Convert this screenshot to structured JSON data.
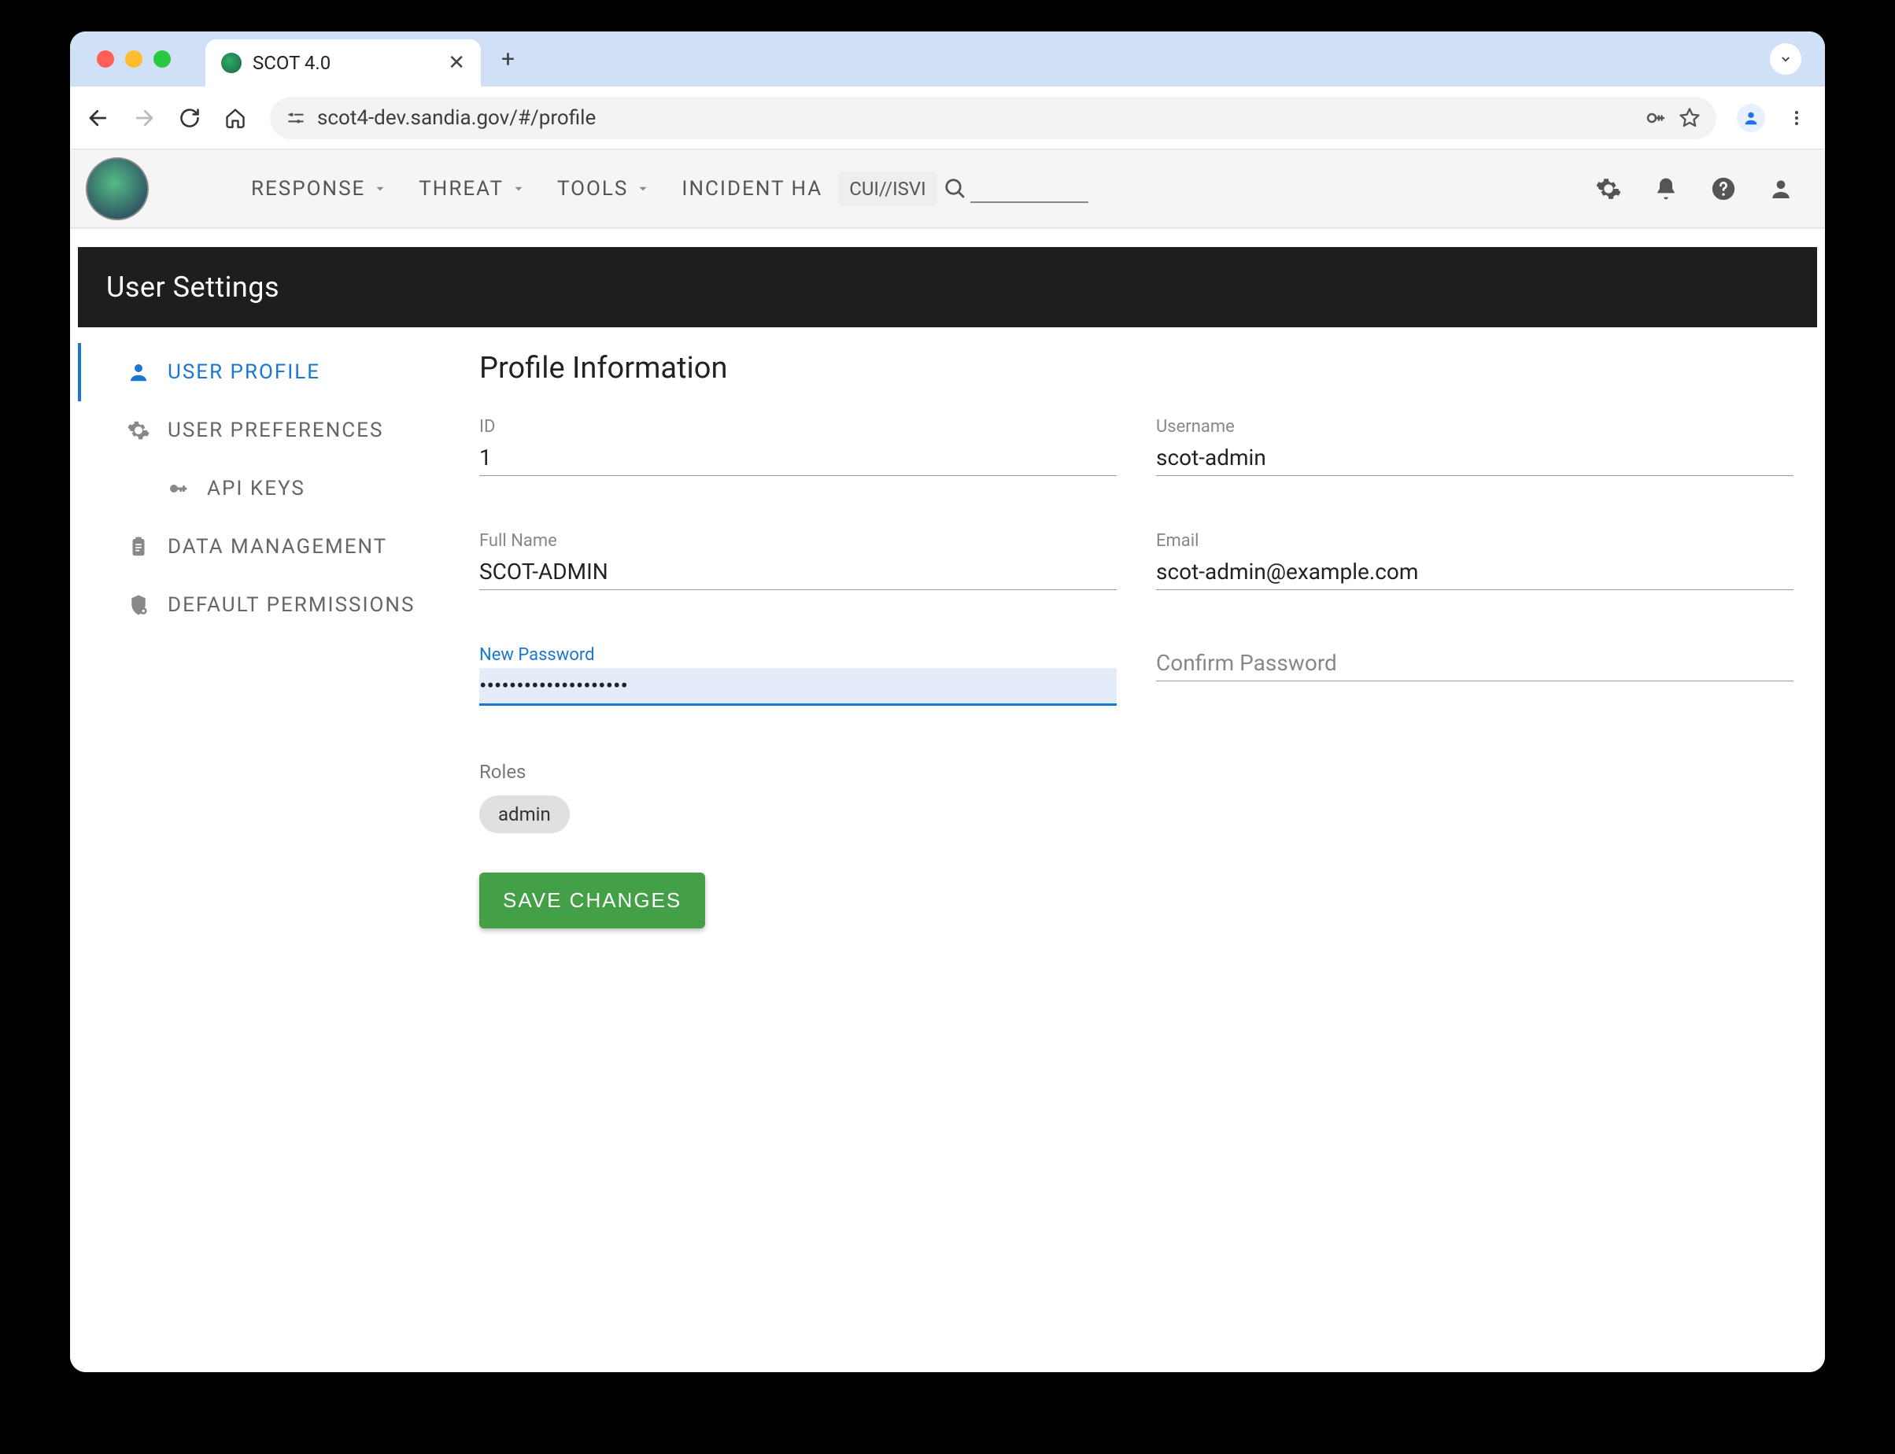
{
  "browser": {
    "tab_title": "SCOT 4.0",
    "url": "scot4-dev.sandia.gov/#/profile"
  },
  "app_nav": {
    "items": [
      "RESPONSE",
      "THREAT",
      "TOOLS",
      "INCIDENT HA"
    ],
    "classification": "CUI//ISVI"
  },
  "page": {
    "header": "User Settings",
    "side_nav": [
      {
        "label": "USER PROFILE",
        "icon": "person",
        "active": true
      },
      {
        "label": "USER PREFERENCES",
        "icon": "gear",
        "active": false
      },
      {
        "label": "API KEYS",
        "icon": "key",
        "active": false
      },
      {
        "label": "DATA MANAGEMENT",
        "icon": "clipboard",
        "active": false
      },
      {
        "label": "DEFAULT PERMISSIONS",
        "icon": "shield",
        "active": false
      }
    ],
    "panel_title": "Profile Information",
    "fields": {
      "id": {
        "label": "ID",
        "value": "1"
      },
      "username": {
        "label": "Username",
        "value": "scot-admin"
      },
      "fullname": {
        "label": "Full Name",
        "value": "SCOT-ADMIN"
      },
      "email": {
        "label": "Email",
        "value": "scot-admin@example.com"
      },
      "new_password": {
        "label": "New Password",
        "value": "••••••••••••••••••••"
      },
      "confirm_password": {
        "label": "Confirm Password",
        "value": ""
      }
    },
    "roles": {
      "label": "Roles",
      "values": [
        "admin"
      ]
    },
    "save_button": "SAVE CHANGES"
  }
}
